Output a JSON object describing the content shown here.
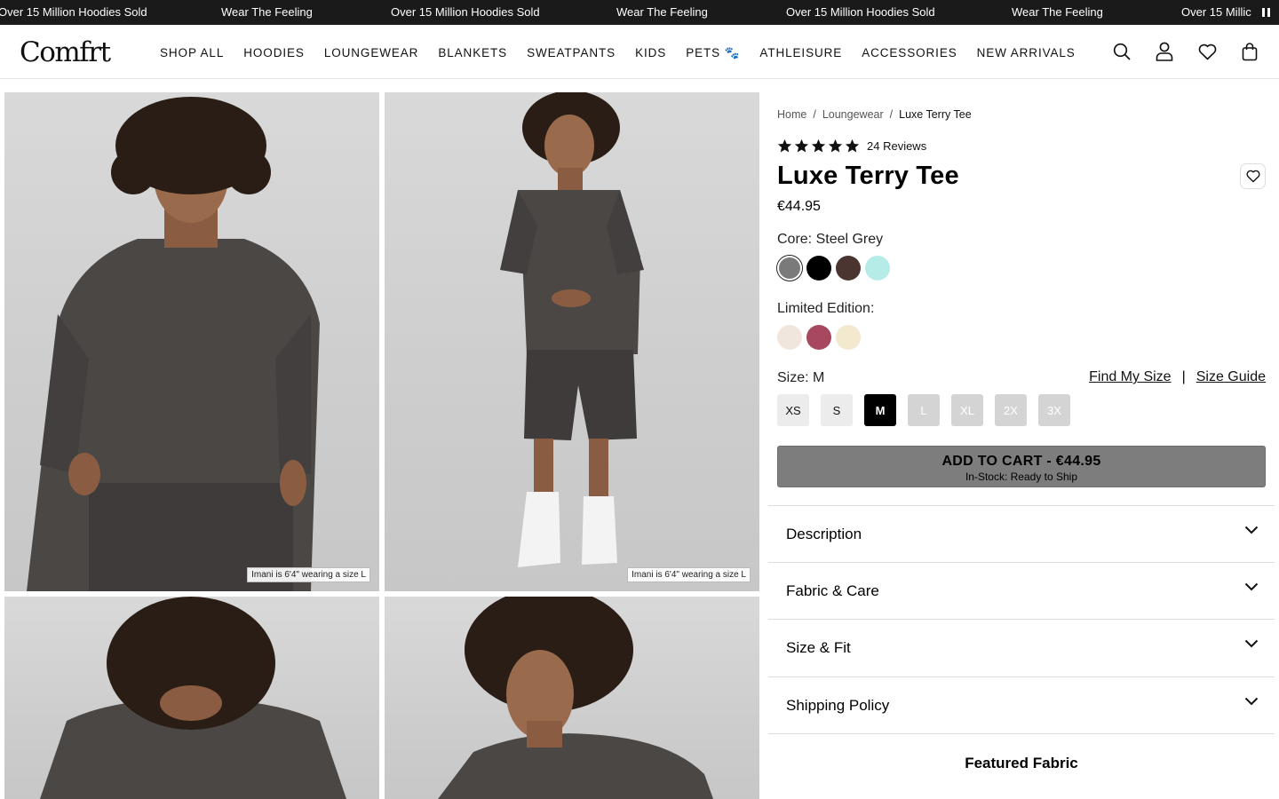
{
  "announcement": {
    "items": [
      "Over 15 Million Hoodies Sold",
      "Wear The Feeling",
      "Over 15 Million Hoodies Sold",
      "Wear The Feeling",
      "Over 15 Million Hoodies Sold",
      "Wear The Feeling",
      "Over 15 Millic"
    ]
  },
  "header": {
    "logo": "Comfrt",
    "nav": [
      "SHOP ALL",
      "HOODIES",
      "LOUNGEWEAR",
      "BLANKETS",
      "SWEATPANTS",
      "KIDS",
      "PETS 🐾",
      "ATHLEISURE",
      "ACCESSORIES",
      "NEW ARRIVALS"
    ],
    "icons": [
      "search-icon",
      "account-icon",
      "wishlist-icon",
      "cart-icon"
    ]
  },
  "gallery": {
    "captions": [
      "Imani is 6'4\" wearing a size L",
      "Imani is 6'4\" wearing a size L"
    ]
  },
  "product": {
    "breadcrumb": [
      "Home",
      "Loungewear",
      "Luxe Terry Tee"
    ],
    "rating_stars": 5,
    "reviews": "24 Reviews",
    "title": "Luxe Terry Tee",
    "price": "€44.95",
    "core_label": "Core: Steel Grey",
    "core_colors": [
      "#7a7a7a",
      "#000000",
      "#4a3530",
      "#b6ece8"
    ],
    "limited_label": "Limited Edition:",
    "limited_colors": [
      "#f1e6dd",
      "#a8485e",
      "#f2e9cf"
    ],
    "size_label": "Size: M",
    "find_my_size": "Find My Size",
    "separator": "|",
    "size_guide": "Size Guide",
    "sizes": [
      {
        "label": "XS",
        "state": "available"
      },
      {
        "label": "S",
        "state": "available"
      },
      {
        "label": "M",
        "state": "selected"
      },
      {
        "label": "L",
        "state": "sold-out"
      },
      {
        "label": "XL",
        "state": "sold-out"
      },
      {
        "label": "2X",
        "state": "sold-out"
      },
      {
        "label": "3X",
        "state": "sold-out"
      }
    ],
    "add_to_cart": "ADD TO CART - €44.95",
    "stock_status": "In-Stock: Ready to Ship",
    "accordions": [
      "Description",
      "Fabric & Care",
      "Size & Fit",
      "Shipping Policy"
    ],
    "featured_heading": "Featured Fabric"
  },
  "colors": {
    "announce_bg": "#1a1a1a",
    "atc_bg": "#7d7d7d",
    "shirt": "#4a4745"
  }
}
